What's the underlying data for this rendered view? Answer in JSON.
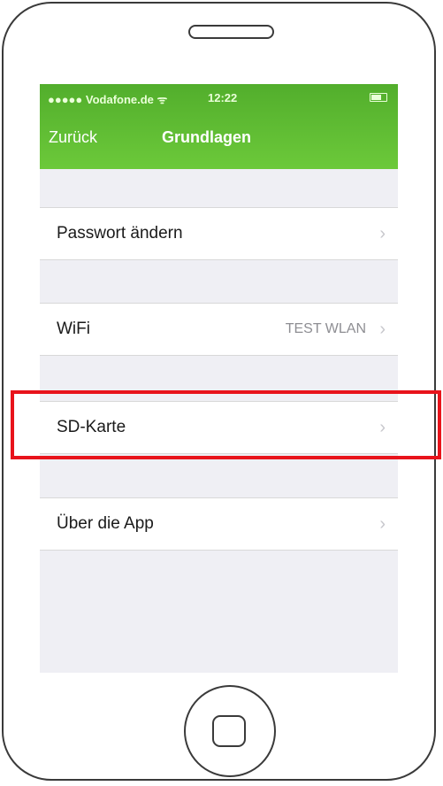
{
  "status_bar": {
    "carrier": "●●●●● Vodafone.de ᯤ",
    "time": "12:22"
  },
  "nav": {
    "back_label": "Zurück",
    "title": "Grundlagen"
  },
  "rows": [
    {
      "label": "Passwort ändern",
      "value": "",
      "chevron": "›"
    },
    {
      "label": "WiFi",
      "value": "TEST WLAN",
      "chevron": "›"
    },
    {
      "label": "SD-Karte",
      "value": "",
      "chevron": "›"
    },
    {
      "label": "Über die App",
      "value": "",
      "chevron": "›"
    }
  ],
  "colors": {
    "nav_green": "#5cb830",
    "highlight_red": "#e8131b",
    "background": "#efeff4"
  },
  "highlighted_row": "SD-Karte"
}
